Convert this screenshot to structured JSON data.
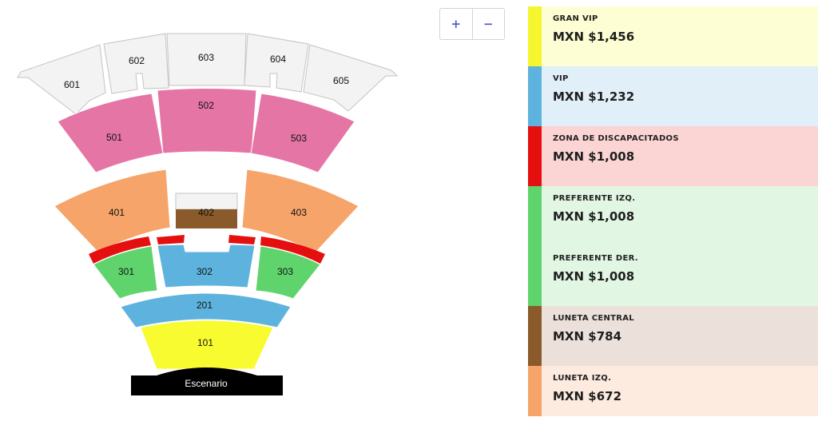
{
  "controls": {
    "zoom_in": "+",
    "zoom_out": "−"
  },
  "sections": {
    "s601": "601",
    "s602": "602",
    "s603": "603",
    "s604": "604",
    "s605": "605",
    "s501": "501",
    "s502": "502",
    "s503": "503",
    "s401": "401",
    "s402": "402",
    "s403": "403",
    "s301": "301",
    "s302": "302",
    "s303": "303",
    "s201": "201",
    "s101": "101",
    "stage": "Escenario"
  },
  "tiers": [
    {
      "name": "GRAN VIP",
      "price": "MXN $1,456",
      "color": "#f5f530",
      "tint": "#fdfed3"
    },
    {
      "name": "VIP",
      "price": "MXN $1,232",
      "color": "#5db3dd",
      "tint": "#e1eff9"
    },
    {
      "name": "ZONA DE DISCAPACITADOS",
      "price": "MXN $1,008",
      "color": "#e50f0f",
      "tint": "#fbd4d4"
    },
    {
      "name": "PREFERENTE IZQ.",
      "price": "MXN $1,008",
      "color": "#5fd46c",
      "tint": "#e1f6e3"
    },
    {
      "name": "PREFERENTE DER.",
      "price": "MXN $1,008",
      "color": "#5fd46c",
      "tint": "#e1f6e3"
    },
    {
      "name": "LUNETA CENTRAL",
      "price": "MXN $784",
      "color": "#8b5a2b",
      "tint": "#ebe0da"
    },
    {
      "name": "LUNETA IZQ.",
      "price": "MXN $672",
      "color": "#f6a469",
      "tint": "#fdebe0"
    }
  ]
}
